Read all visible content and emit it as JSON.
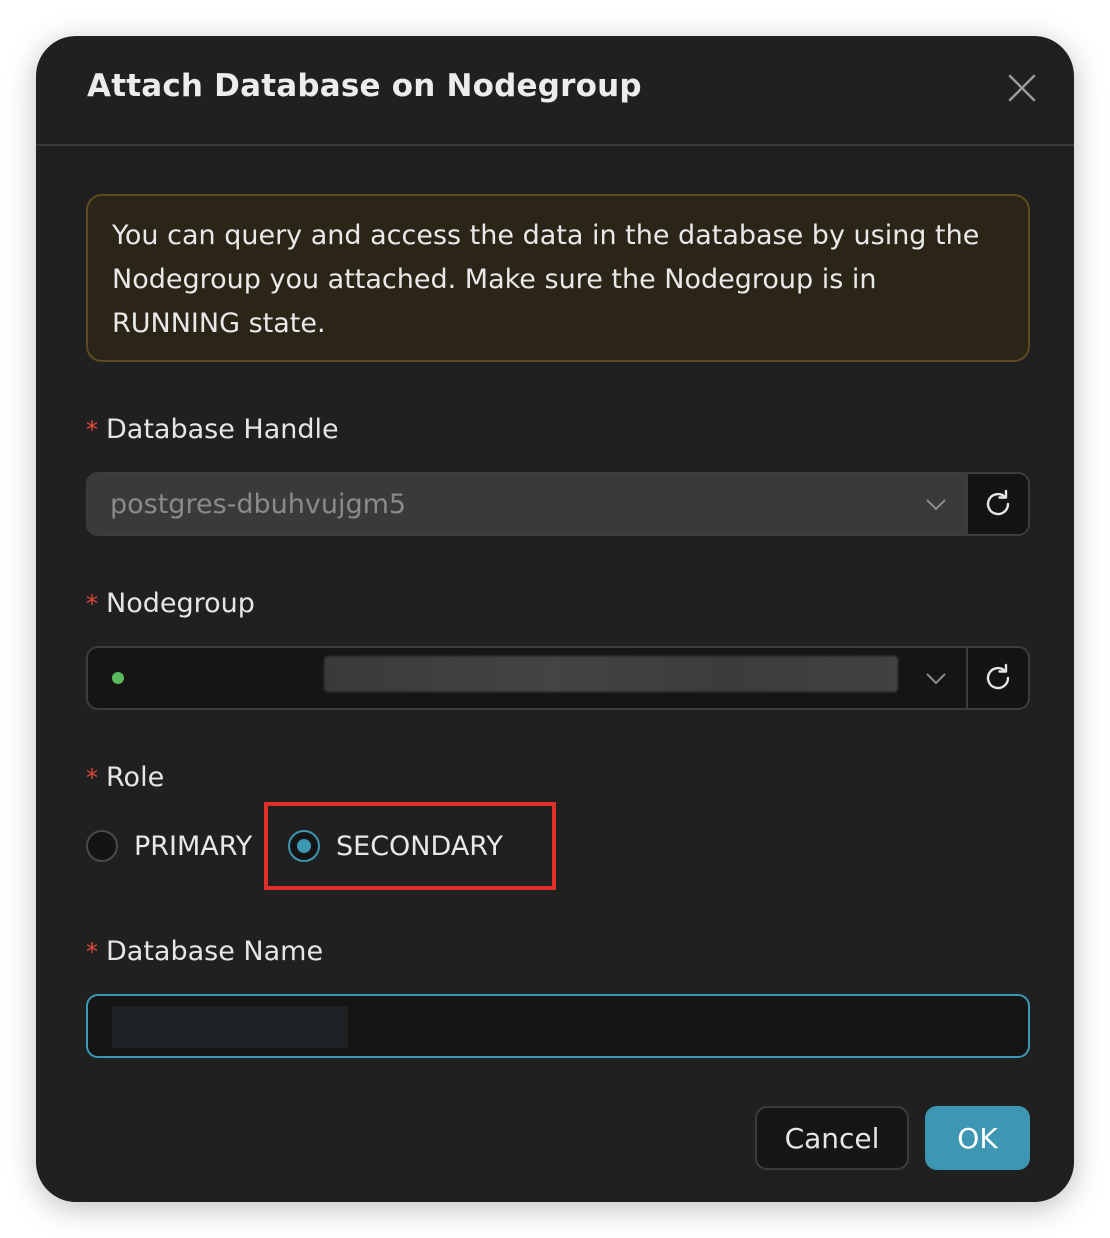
{
  "dialog": {
    "title": "Attach Database on Nodegroup",
    "alert_text": "You can query and access the data in the database by using the Nodegroup you attached. Make sure the Nodegroup is in RUNNING state."
  },
  "form": {
    "database_handle": {
      "label": "Database Handle",
      "required_mark": "*",
      "value": "postgres-dbuhvujgm5"
    },
    "nodegroup": {
      "label": "Nodegroup",
      "required_mark": "*",
      "status_color": "#5cb85c"
    },
    "role": {
      "label": "Role",
      "required_mark": "*",
      "options": [
        {
          "label": "PRIMARY",
          "checked": false
        },
        {
          "label": "SECONDARY",
          "checked": true
        }
      ]
    },
    "database_name": {
      "label": "Database Name",
      "required_mark": "*"
    }
  },
  "footer": {
    "cancel_label": "Cancel",
    "ok_label": "OK"
  },
  "colors": {
    "accent": "#3d97b3",
    "required": "#e04a3a",
    "highlight": "#e0302a"
  }
}
